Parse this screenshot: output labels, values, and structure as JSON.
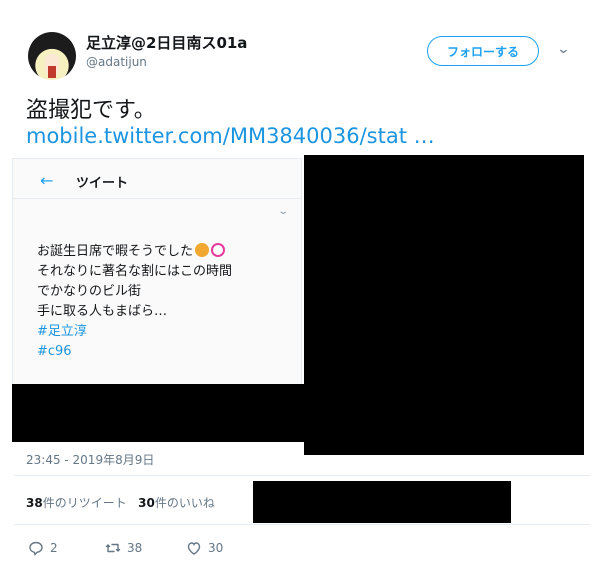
{
  "tweet": {
    "display_name": "足立淳@2日目南ス01a",
    "handle": "@adatijun",
    "follow_label": "フォローする",
    "text": "盗撮犯です。",
    "link_text": "mobile.twitter.com/MM3840036/stat …",
    "timestamp": "23:45 - 2019年8月9日",
    "retweet_count": "38",
    "retweet_label": "件のリツイート",
    "like_count": "30",
    "like_label": "件のいいね",
    "reply_action_count": "2",
    "retweet_action_count": "38",
    "like_action_count": "30"
  },
  "embedded": {
    "header_title": "ツイート",
    "lines": [
      "お誕生日席で暇そうでした",
      "それなりに著名な割にはこの時間",
      "でかなりのビル街",
      "手に取る人もまばら…"
    ],
    "hashtags": [
      "#足立淳",
      "#c96"
    ]
  },
  "colors": {
    "accent": "#1da1f2",
    "link": "#1b95e0",
    "muted": "#657786",
    "redaction": "#000000"
  },
  "icons": {
    "back": "arrow-left-icon",
    "more": "chevron-down-icon",
    "reply": "reply-icon",
    "retweet": "retweet-icon",
    "like": "heart-icon"
  }
}
